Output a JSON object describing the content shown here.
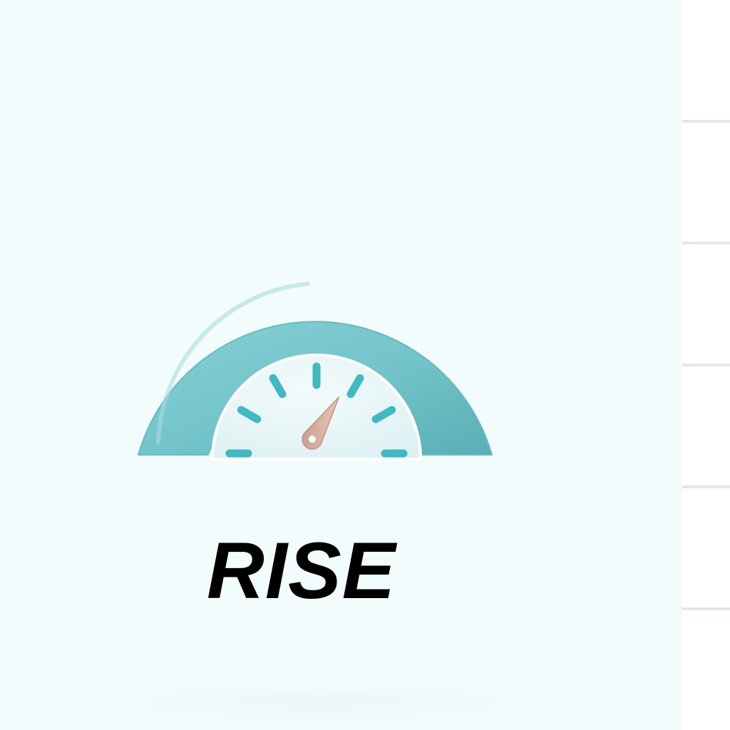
{
  "caption": {
    "text": "RISE"
  },
  "gauge": {
    "icon": "speedometer-icon",
    "needle_level": 0.68,
    "tick_count": 7
  },
  "colors": {
    "background": "#f3fcfc",
    "arc": "#74c6cc",
    "arc_shadow": "#5aaeb5",
    "dial_face": "#e8f6f7",
    "tick": "#42b8c1",
    "needle": "#d7b3a5",
    "caption": "#000000",
    "side_divider": "#e3e6ea"
  }
}
